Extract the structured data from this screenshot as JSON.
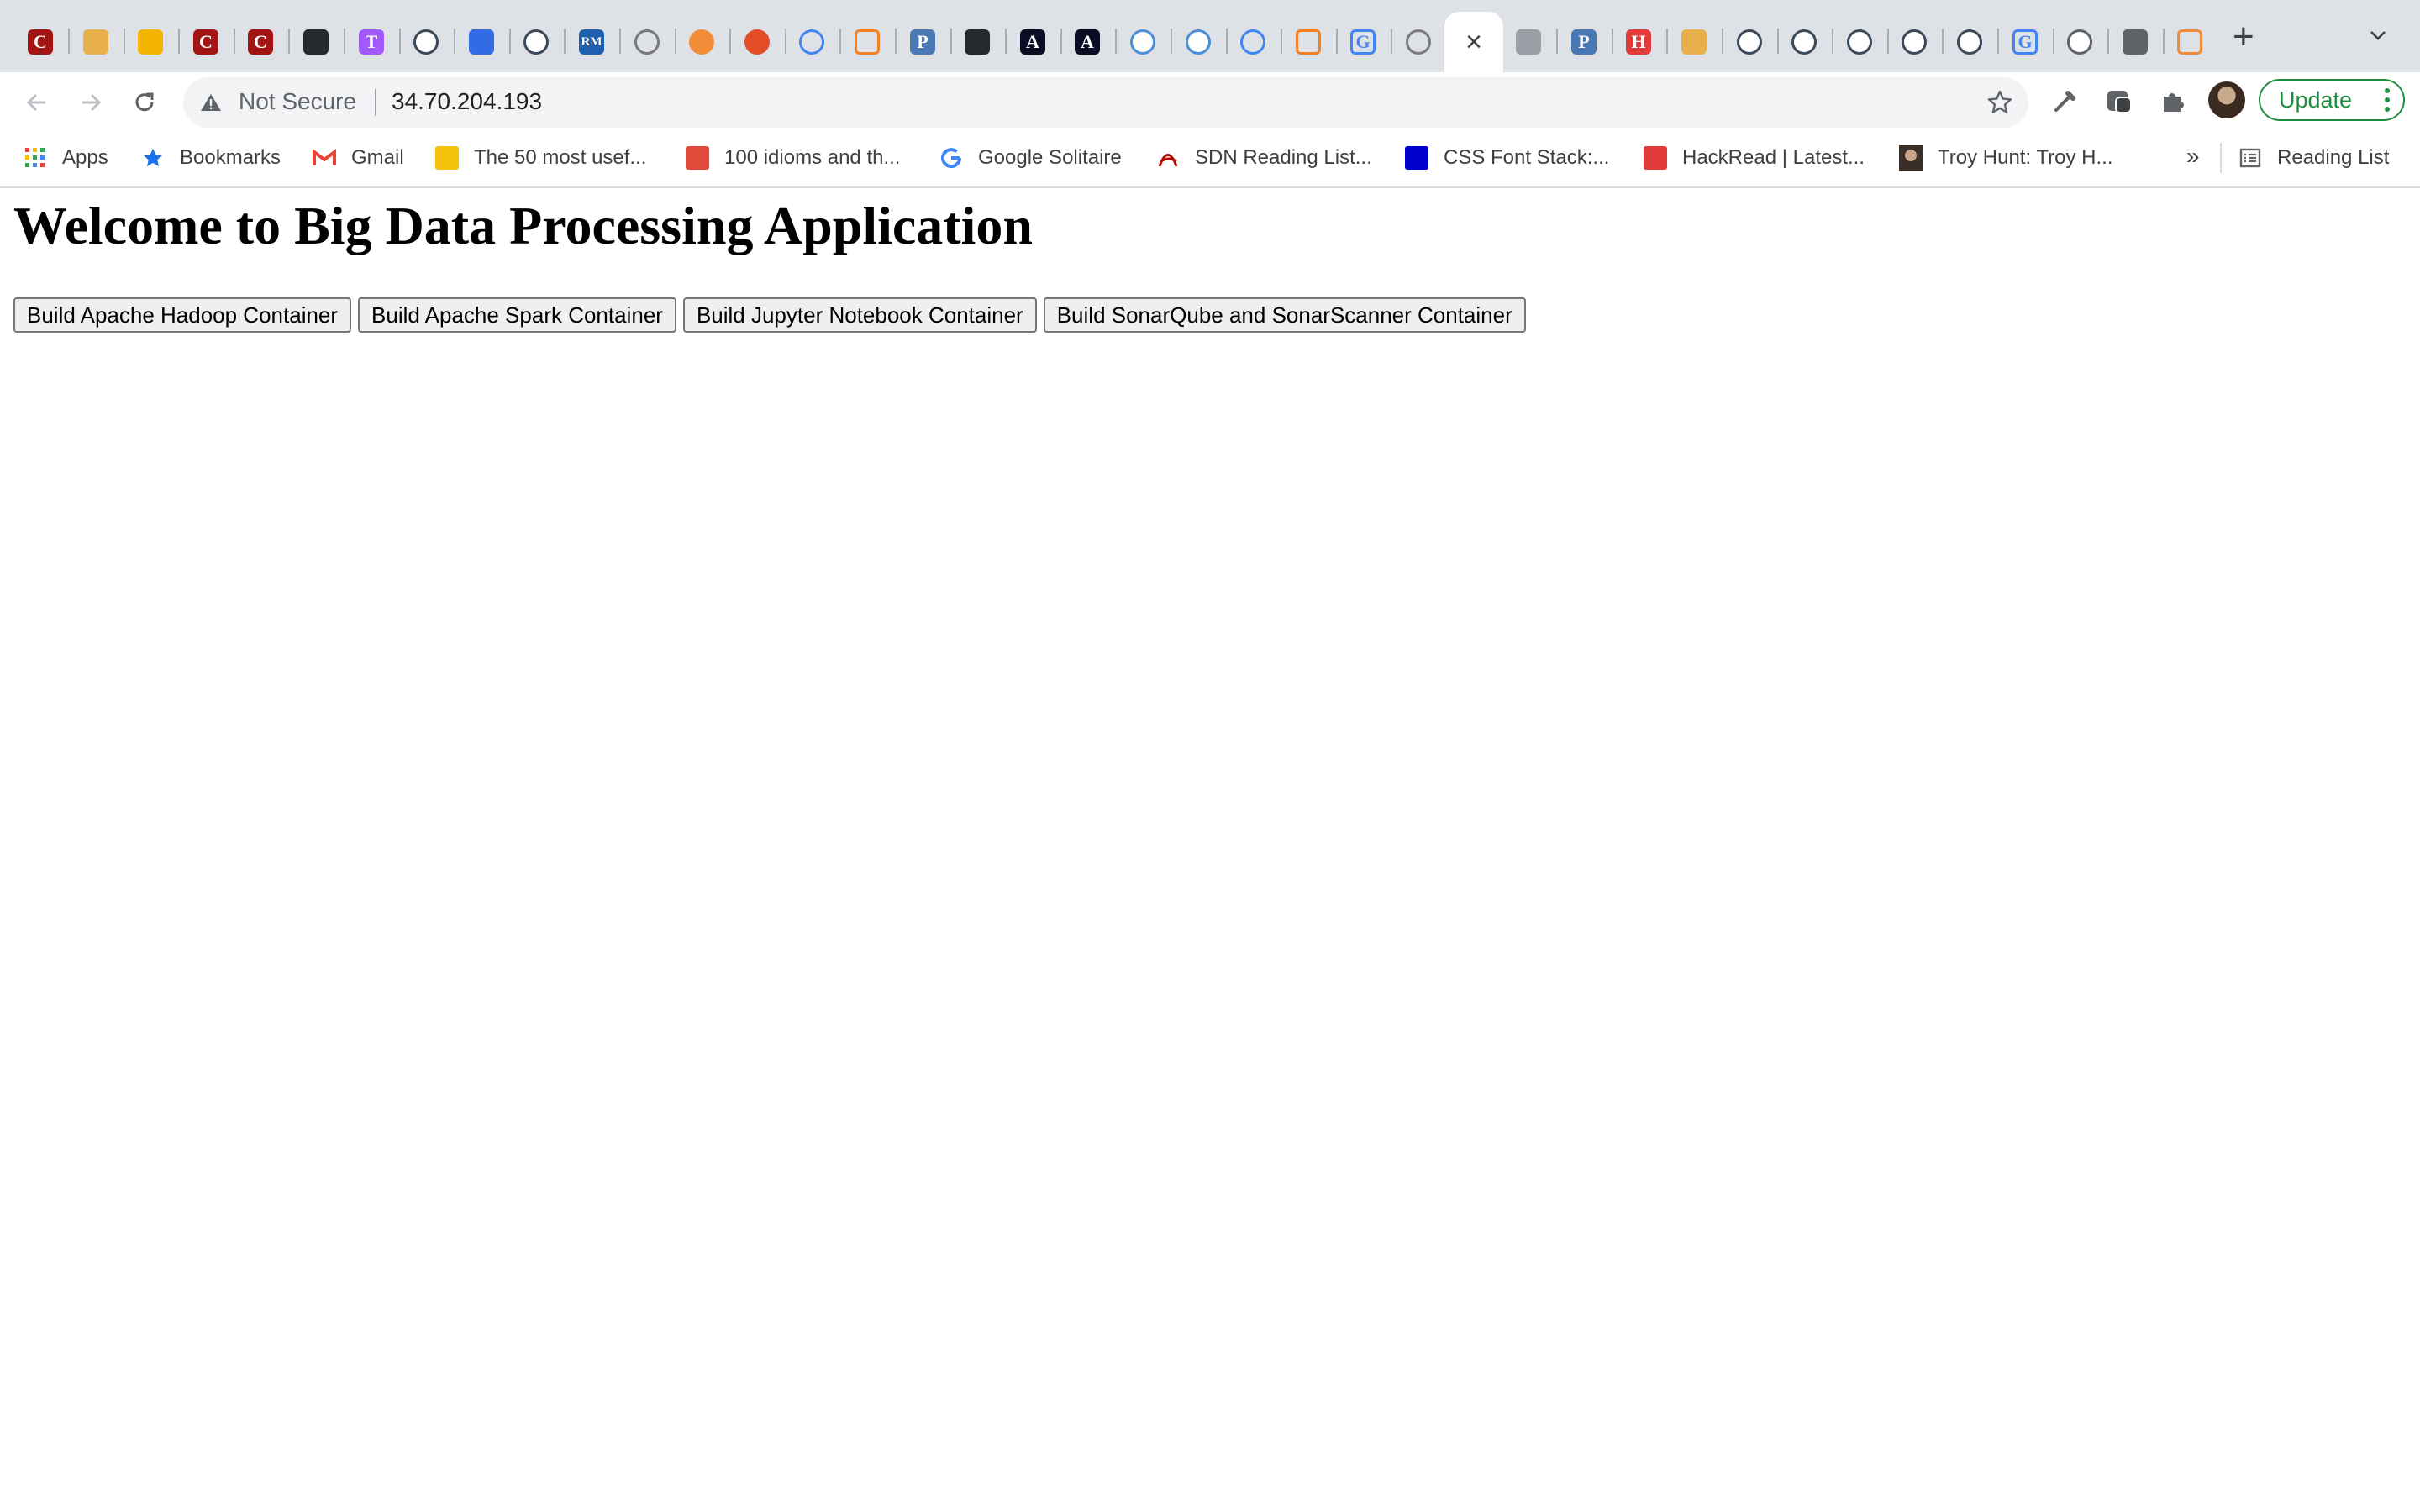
{
  "tabs": [
    {
      "icon": "c-letter-icon",
      "color": "#a31515",
      "glyph": "C"
    },
    {
      "icon": "box-icon",
      "color": "#e8b04a",
      "glyph": ""
    },
    {
      "icon": "slides-icon",
      "color": "#f4b400",
      "glyph": ""
    },
    {
      "icon": "c-letter-icon",
      "color": "#a31515",
      "glyph": "C"
    },
    {
      "icon": "c-letter-icon",
      "color": "#a31515",
      "glyph": "C"
    },
    {
      "icon": "github-icon",
      "color": "#24292e",
      "glyph": ""
    },
    {
      "icon": "t-letter-icon",
      "color": "#a259ff",
      "glyph": "T"
    },
    {
      "icon": "docker-icon",
      "color": "#3b4a5a",
      "glyph": ""
    },
    {
      "icon": "kubernetes-icon",
      "color": "#326ce5",
      "glyph": ""
    },
    {
      "icon": "docker-icon",
      "color": "#3b4a5a",
      "glyph": ""
    },
    {
      "icon": "rm-icon",
      "color": "#1f5fb0",
      "glyph": "RM"
    },
    {
      "icon": "hexagon-icon",
      "color": "#7a7a7a",
      "glyph": ""
    },
    {
      "icon": "dots-icon",
      "color": "#f28c38",
      "glyph": ""
    },
    {
      "icon": "circle-icon",
      "color": "#e44d26",
      "glyph": ""
    },
    {
      "icon": "google-cloud-icon",
      "color": "#4285f4",
      "glyph": ""
    },
    {
      "icon": "stackoverflow-icon",
      "color": "#f48024",
      "glyph": ""
    },
    {
      "icon": "p-letter-icon",
      "color": "#4a78b5",
      "glyph": "P"
    },
    {
      "icon": "github-icon",
      "color": "#24292e",
      "glyph": ""
    },
    {
      "icon": "a-letter-icon",
      "color": "#0c0c24",
      "glyph": "A"
    },
    {
      "icon": "a-letter-icon",
      "color": "#0c0c24",
      "glyph": "A"
    },
    {
      "icon": "docker-icon",
      "color": "#4a8fd8",
      "glyph": ""
    },
    {
      "icon": "docker-icon",
      "color": "#4a8fd8",
      "glyph": ""
    },
    {
      "icon": "google-cloud-icon",
      "color": "#4285f4",
      "glyph": ""
    },
    {
      "icon": "stackoverflow-icon",
      "color": "#f48024",
      "glyph": ""
    },
    {
      "icon": "google-icon",
      "color": "#4285f4",
      "glyph": "G"
    },
    {
      "icon": "hexagon-icon",
      "color": "#7a7a7a",
      "glyph": ""
    },
    {
      "icon": "close-icon",
      "color": "#3c4043",
      "glyph": "×",
      "active": true
    },
    {
      "icon": "terminal-icon",
      "color": "#9aa0a6",
      "glyph": ""
    },
    {
      "icon": "p-letter-icon",
      "color": "#4a78b5",
      "glyph": "P"
    },
    {
      "icon": "h-letter-icon",
      "color": "#e23a3a",
      "glyph": "H"
    },
    {
      "icon": "box-icon",
      "color": "#e8b04a",
      "glyph": ""
    },
    {
      "icon": "docker-icon",
      "color": "#3b4a5a",
      "glyph": ""
    },
    {
      "icon": "docker-icon",
      "color": "#3b4a5a",
      "glyph": ""
    },
    {
      "icon": "docker-icon",
      "color": "#3b4a5a",
      "glyph": ""
    },
    {
      "icon": "docker-icon",
      "color": "#3b4a5a",
      "glyph": ""
    },
    {
      "icon": "docker-icon",
      "color": "#3b4a5a",
      "glyph": ""
    },
    {
      "icon": "google-icon",
      "color": "#4285f4",
      "glyph": "G"
    },
    {
      "icon": "globe-icon",
      "color": "#5f6368",
      "glyph": ""
    },
    {
      "icon": "book-icon",
      "color": "#5f6368",
      "glyph": ""
    },
    {
      "icon": "arc-icon",
      "color": "#f28c38",
      "glyph": ""
    }
  ],
  "omnibox": {
    "security_label": "Not Secure",
    "url": "34.70.204.193"
  },
  "toolbar": {
    "update_label": "Update"
  },
  "bookmarks": [
    {
      "label": "Apps",
      "icon": "apps-grid-icon",
      "color": "#4285f4"
    },
    {
      "label": "Bookmarks",
      "icon": "star-icon",
      "color": "#1a73e8"
    },
    {
      "label": "Gmail",
      "icon": "gmail-icon",
      "color": "#ea4335"
    },
    {
      "label": "The 50 most usef...",
      "icon": "w-letter-icon",
      "color": "#f4c20d"
    },
    {
      "label": "100 idioms and th...",
      "icon": "c-letter-icon",
      "color": "#e04a3a"
    },
    {
      "label": "Google Solitaire",
      "icon": "google-icon",
      "color": "#4285f4"
    },
    {
      "label": "SDN Reading List...",
      "icon": "acrobat-icon",
      "color": "#b30b00"
    },
    {
      "label": "CSS Font Stack:...",
      "icon": "font-stack-icon",
      "color": "#0000cc"
    },
    {
      "label": "HackRead | Latest...",
      "icon": "hr-letter-icon",
      "color": "#e23a3a"
    },
    {
      "label": "Troy Hunt: Troy H...",
      "icon": "portrait-icon",
      "color": "#5a4a40"
    }
  ],
  "bookmarks_bar": {
    "more_label": "»",
    "reading_list_label": "Reading List"
  },
  "page": {
    "heading": "Welcome to Big Data Processing Application",
    "buttons": [
      "Build Apache Hadoop Container",
      "Build Apache Spark Container",
      "Build Jupyter Notebook Container",
      "Build SonarQube and SonarScanner Container"
    ]
  }
}
